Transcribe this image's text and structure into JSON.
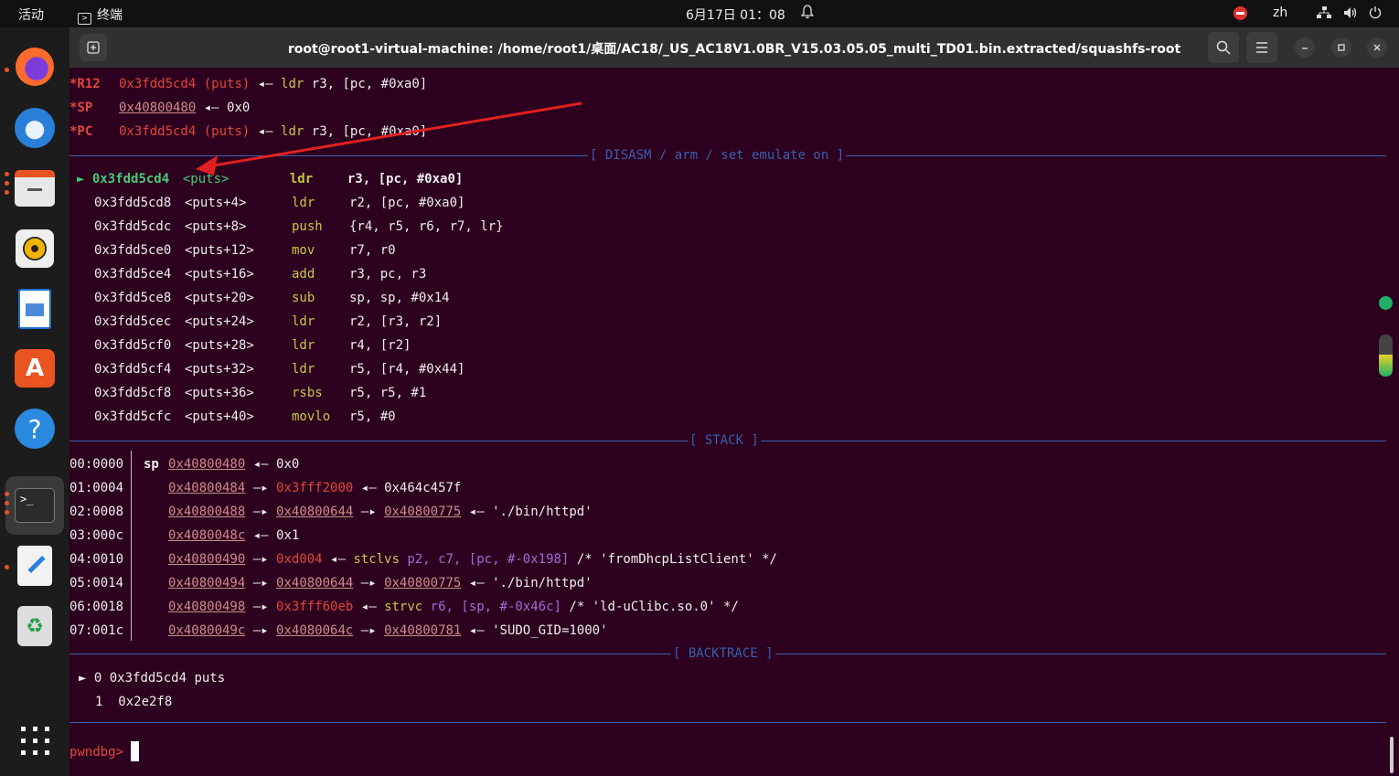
{
  "topbar": {
    "activities": "活动",
    "app_name": "终端",
    "clock": "6月17日 01：08",
    "lang": "zh"
  },
  "window": {
    "title": "root@root1-virtual-machine: /home/root1/桌面/AC18/_US_AC18V1.0BR_V15.03.05.05_multi_TD01.bin.extracted/squashfs-root"
  },
  "registers": [
    {
      "name": "*R12",
      "value": "0x3fdd5cd4",
      "sym": "(puts)",
      "arrow": "◂—",
      "rest_op": "ldr",
      "rest_args": "r3, [pc, #0xa0]"
    },
    {
      "name": "*SP",
      "value": "0x40800480",
      "arrow": "◂—",
      "rest_plain": "0x0"
    },
    {
      "name": "*PC",
      "value": "0x3fdd5cd4",
      "sym": "(puts)",
      "arrow": "◂—",
      "rest_op": "ldr",
      "rest_args": "r3, [pc, #0xa0]"
    }
  ],
  "sections": {
    "disasm": "[ DISASM / arm / set emulate on ]",
    "stack": "[ STACK ]",
    "backtrace": "[ BACKTRACE ]"
  },
  "disasm": [
    {
      "marker": "►",
      "addr": "0x3fdd5cd4",
      "sym": "<puts>",
      "op": "ldr",
      "args": "r3, [pc, #0xa0]"
    },
    {
      "addr": "0x3fdd5cd8",
      "sym": "<puts+4>",
      "op": "ldr",
      "args": "r2, [pc, #0xa0]"
    },
    {
      "addr": "0x3fdd5cdc",
      "sym": "<puts+8>",
      "op": "push",
      "args": "{r4, r5, r6, r7, lr}"
    },
    {
      "addr": "0x3fdd5ce0",
      "sym": "<puts+12>",
      "op": "mov",
      "args": "r7, r0"
    },
    {
      "addr": "0x3fdd5ce4",
      "sym": "<puts+16>",
      "op": "add",
      "args": "r3, pc, r3"
    },
    {
      "addr": "0x3fdd5ce8",
      "sym": "<puts+20>",
      "op": "sub",
      "args": "sp, sp, #0x14"
    },
    {
      "addr": "0x3fdd5cec",
      "sym": "<puts+24>",
      "op": "ldr",
      "args": "r2, [r3, r2]"
    },
    {
      "addr": "0x3fdd5cf0",
      "sym": "<puts+28>",
      "op": "ldr",
      "args": "r4, [r2]"
    },
    {
      "addr": "0x3fdd5cf4",
      "sym": "<puts+32>",
      "op": "ldr",
      "args": "r5, [r4, #0x44]"
    },
    {
      "addr": "0x3fdd5cf8",
      "sym": "<puts+36>",
      "op": "rsbs",
      "args": "r5, r5, #1"
    },
    {
      "addr": "0x3fdd5cfc",
      "sym": "<puts+40>",
      "op": "movlo",
      "args": "r5, #0"
    }
  ],
  "stack": [
    {
      "idx": "00:0000",
      "reg": "sp",
      "a1": "0x40800480",
      "t1": "◂—",
      "tail": "0x0"
    },
    {
      "idx": "01:0004",
      "a1": "0x40800484",
      "t1": "—▸",
      "a2": "0x3fff2000",
      "a2red": true,
      "t2": "◂—",
      "tail": "0x464c457f"
    },
    {
      "idx": "02:0008",
      "a1": "0x40800488",
      "t1": "—▸",
      "a2": "0x40800644",
      "t2": "—▸",
      "a3": "0x40800775",
      "t3": "◂—",
      "tail": "'./bin/httpd'"
    },
    {
      "idx": "03:000c",
      "a1": "0x4080048c",
      "t1": "◂—",
      "tail": "0x1"
    },
    {
      "idx": "04:0010",
      "a1": "0x40800490",
      "t1": "—▸",
      "a2": "0xd004",
      "a2red": true,
      "t2": "◂—",
      "insn_op": "stclvs",
      "insn_args": "p2, c7, [pc, #-0x198]",
      "tail": "/* 'fromDhcpListClient' */"
    },
    {
      "idx": "05:0014",
      "a1": "0x40800494",
      "t1": "—▸",
      "a2": "0x40800644",
      "t2": "—▸",
      "a3": "0x40800775",
      "t3": "◂—",
      "tail": "'./bin/httpd'"
    },
    {
      "idx": "06:0018",
      "a1": "0x40800498",
      "t1": "—▸",
      "a2": "0x3fff60eb",
      "a2red": true,
      "t2": "◂—",
      "insn_op": "strvc",
      "insn_args": "r6, [sp, #-0x46c]",
      "tail": "/* 'ld-uClibc.so.0' */"
    },
    {
      "idx": "07:001c",
      "a1": "0x4080049c",
      "t1": "—▸",
      "a2": "0x4080064c",
      "t2": "—▸",
      "a3": "0x40800781",
      "t3": "◂—",
      "tail": "'SUDO_GID=1000'"
    }
  ],
  "backtrace": [
    {
      "marker": "►",
      "text": "0 0x3fdd5cd4 puts"
    },
    {
      "text": "1  0x2e2f8"
    }
  ],
  "prompt": "pwndbg>",
  "colors": {
    "bg": "#2c001e",
    "red": "#e2473f",
    "green": "#48c878",
    "yellow": "#c9c74a",
    "purple": "#a56ad9",
    "blue": "#3a5fb0"
  }
}
